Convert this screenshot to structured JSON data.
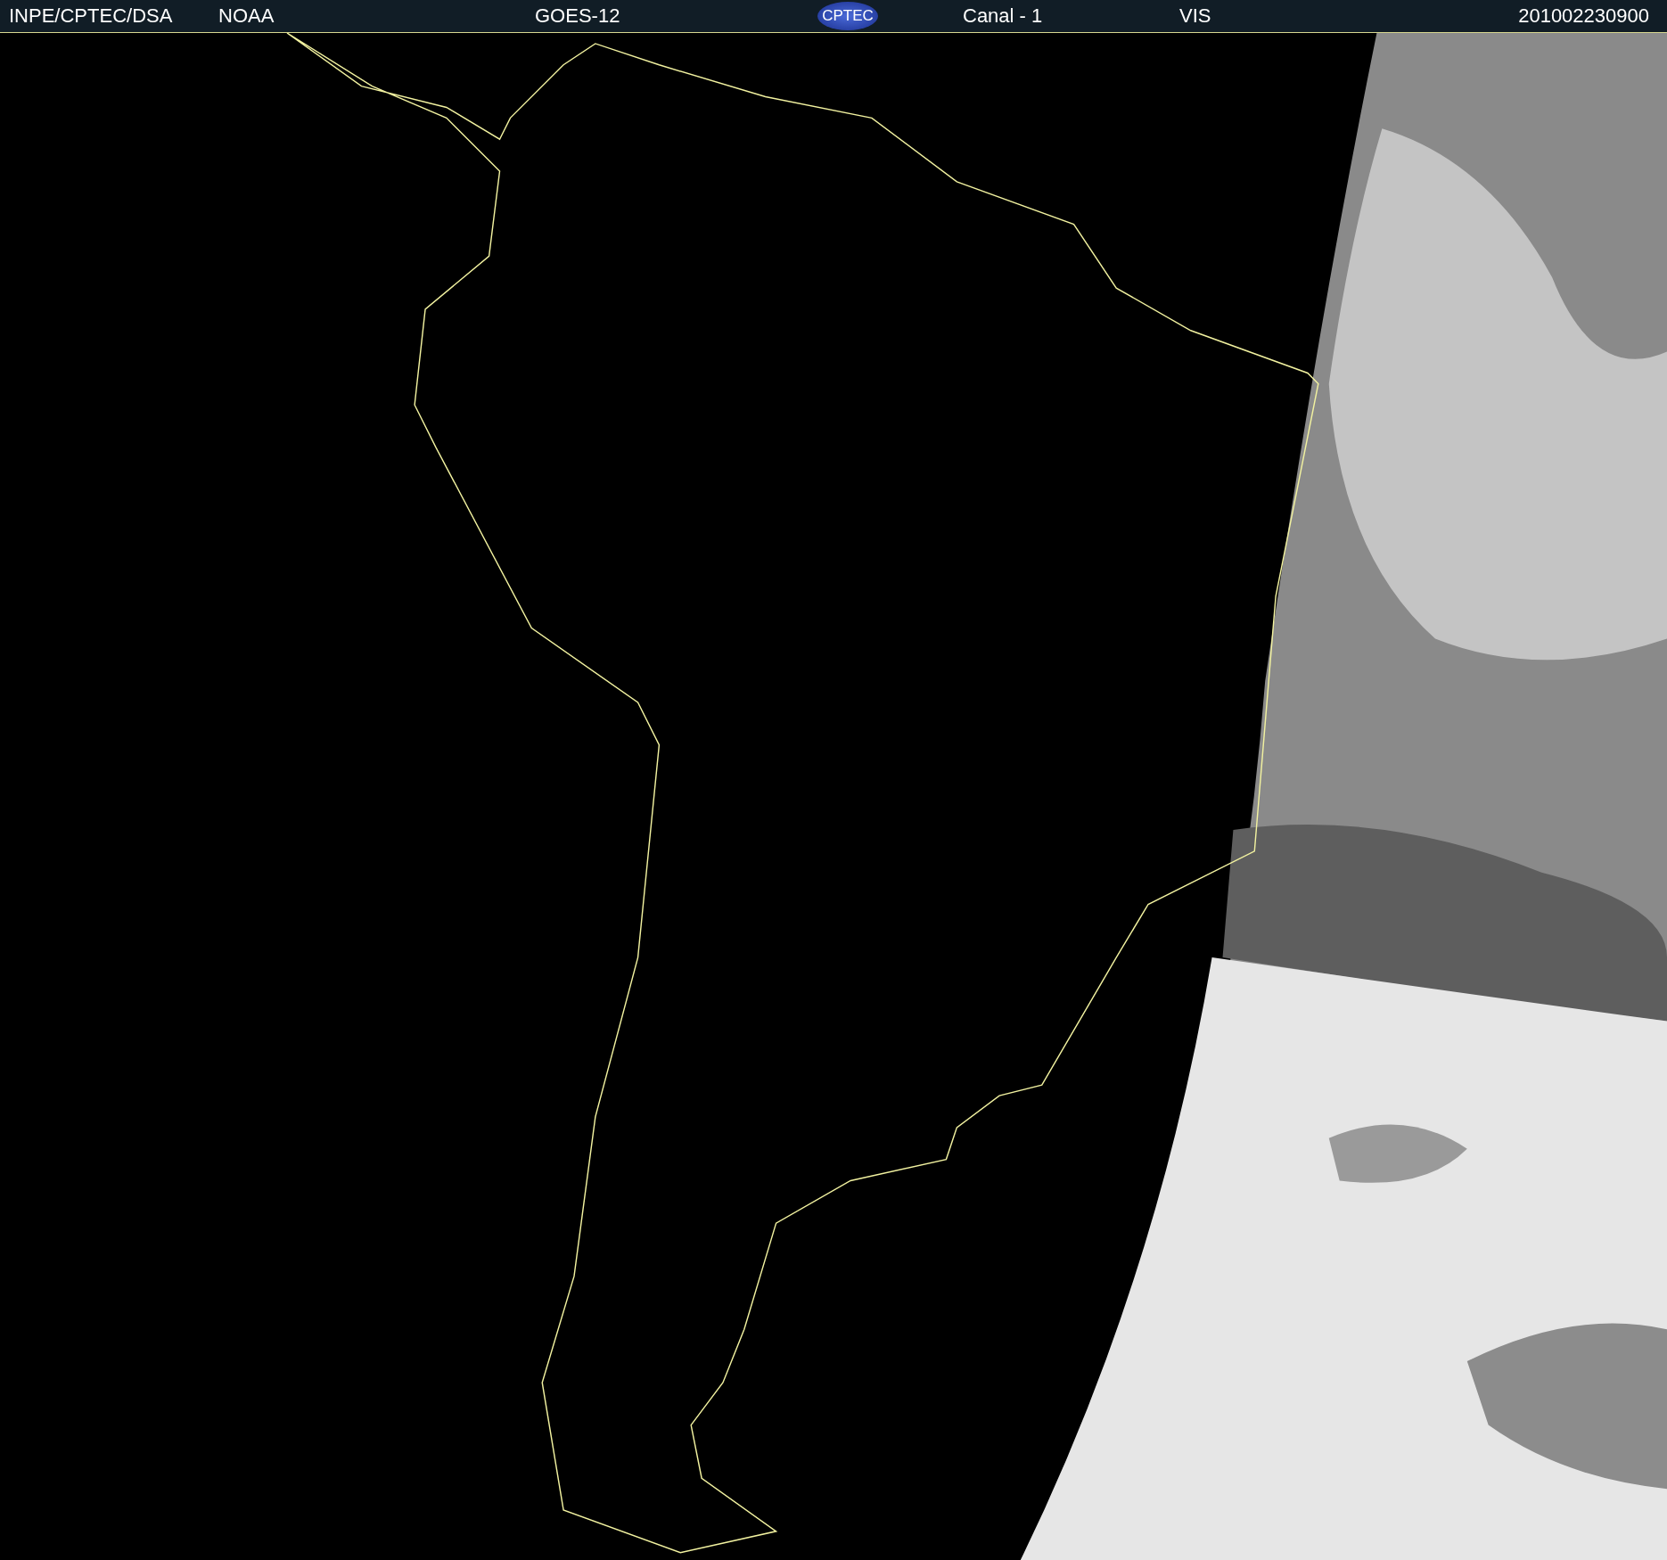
{
  "header": {
    "source": "INPE/CPTEC/DSA",
    "agency": "NOAA",
    "satellite": "GOES-12",
    "logo": "CPTEC",
    "channel": "Canal - 1",
    "band": "VIS",
    "timestamp": "201002230900"
  }
}
